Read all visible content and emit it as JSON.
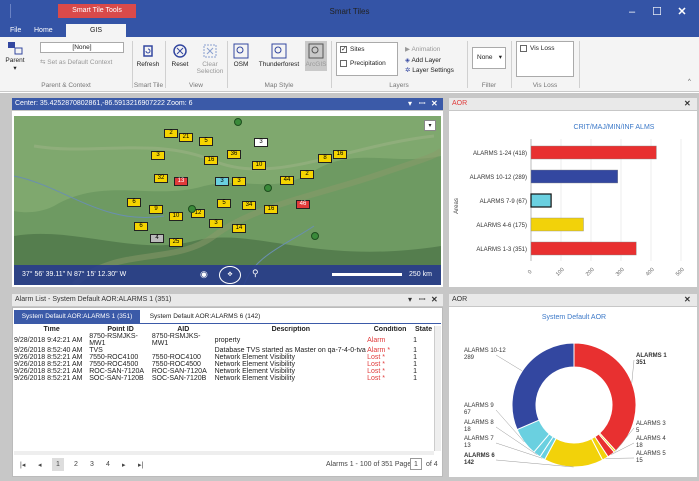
{
  "titlebar": {
    "context_tab": "Smart Tile Tools",
    "title": "Smart Tiles"
  },
  "tabs": [
    {
      "label": "File"
    },
    {
      "label": "Home"
    },
    {
      "label": "GIS"
    }
  ],
  "ribbon": {
    "parent_context": {
      "parent_label": "Parent",
      "selection": "[None]",
      "set_default": "Set as Default Context",
      "group": "Parent & Context"
    },
    "smart_tile": {
      "refresh": "Refresh",
      "group": "Smart Tile"
    },
    "view": {
      "reset": "Reset",
      "clear_selection": "Clear Selection",
      "group": "View"
    },
    "map_style": {
      "osm": "OSM",
      "thunderforest": "Thunderforest",
      "arcgis": "ArcGIS",
      "group": "Map Style"
    },
    "layers": {
      "sites": "Sites",
      "precipitation": "Precipitation",
      "animation": "Animation",
      "add_layer": "Add Layer",
      "layer_settings": "Layer Settings",
      "group": "Layers"
    },
    "filter": {
      "value": "None",
      "group": "Filter"
    },
    "vis_loss": {
      "label": "Vis Loss",
      "group": "Vis Loss"
    }
  },
  "map_panel": {
    "title": "Center: 35.4252870802861,-86.5913216907222  Zoom: 6",
    "coords": "37° 56' 39.11\" N 87° 15' 12.30\" W",
    "scale": "250 km",
    "markers": [
      "2",
      "21",
      "5",
      "36",
      "3",
      "3",
      "8",
      "16",
      "16",
      "10",
      "32",
      "13",
      "3",
      "3",
      "44",
      "2",
      "6",
      "9",
      "10",
      "12",
      "5",
      "34",
      "16",
      "46",
      "6",
      "14",
      "4",
      "25",
      "3"
    ]
  },
  "aor_bar": {
    "tab": "AOR",
    "chart_data": {
      "type": "bar",
      "title": "CRIT/MAJ/MIN/INF ALMS",
      "ylabel": "Areas",
      "categories": [
        "ALARMS 1-24 (418)",
        "ALARMS 10-12 (289)",
        "ALARMS 7-9 (67)",
        "ALARMS 4-6 (175)",
        "ALARMS 1-3 (351)"
      ],
      "values": [
        418,
        289,
        67,
        175,
        351
      ],
      "colors": [
        "#e83030",
        "#3347a0",
        "#6ad0e0",
        "#f2d20a",
        "#e83030"
      ],
      "xticks": [
        "0",
        "100",
        "200",
        "300",
        "400",
        "500"
      ],
      "xlim": [
        0,
        500
      ],
      "grid": true
    }
  },
  "alarm_panel": {
    "title": "Alarm List - System Default AOR:ALARMS 1 (351)",
    "subtabs": [
      {
        "label": "System Default AOR:ALARMS 1 (351)"
      },
      {
        "label": "System Default AOR:ALARMS 6 (142)"
      }
    ],
    "columns": [
      "Time",
      "Point ID",
      "AID",
      "Description",
      "Condition",
      "State"
    ],
    "rows": [
      [
        "9/28/2018 9:42:21 AM",
        "8750-RSMJKS-MW1",
        "8750-RSMJKS-MW1",
        "property",
        "Alarm",
        "1"
      ],
      [
        "9/26/2018 8:52:40 AM",
        "TVS",
        "",
        "Database TVS started as Master on qa-7-4-0-tva",
        "Alarm  *",
        "1"
      ],
      [
        "9/26/2018 8:52:21 AM",
        "7550-ROC4100",
        "7550-ROC4100",
        "Network Element Visibility",
        "Lost  *",
        "1"
      ],
      [
        "9/26/2018 8:52:21 AM",
        "7550-ROC4500",
        "7550-ROC4500",
        "Network Element Visibility",
        "Lost  *",
        "1"
      ],
      [
        "9/26/2018 8:52:21 AM",
        "ROC-SAN-7120A",
        "ROC-SAN-7120A",
        "Network Element Visibility",
        "Lost  *",
        "1"
      ],
      [
        "9/26/2018 8:52:21 AM",
        "SOC-SAN-7120B",
        "SOC-SAN-7120B",
        "Network Element Visibility",
        "Lost  *",
        "1"
      ]
    ],
    "pager": {
      "pages": [
        "1",
        "2",
        "3",
        "4"
      ],
      "summary": "Alarms 1 - 100 of 351 Page",
      "page": "1",
      "of": "of 4"
    }
  },
  "aor_donut": {
    "tab": "AOR",
    "chart_data": {
      "type": "pie",
      "title": "System Default AOR",
      "labels": [
        "ALARMS 1",
        "ALARMS 3",
        "ALARMS 4",
        "ALARMS 5",
        "ALARMS 6",
        "ALARMS 7",
        "ALARMS 8",
        "ALARMS 9",
        "ALARMS 10-12"
      ],
      "values": [
        351,
        5,
        18,
        15,
        142,
        13,
        18,
        67,
        289
      ],
      "colors": [
        "#e83030",
        "#f2d20a",
        "#e83030",
        "#f2d20a",
        "#f2d20a",
        "#6ad0e0",
        "#6ad0e0",
        "#6ad0e0",
        "#3347a0"
      ]
    }
  }
}
